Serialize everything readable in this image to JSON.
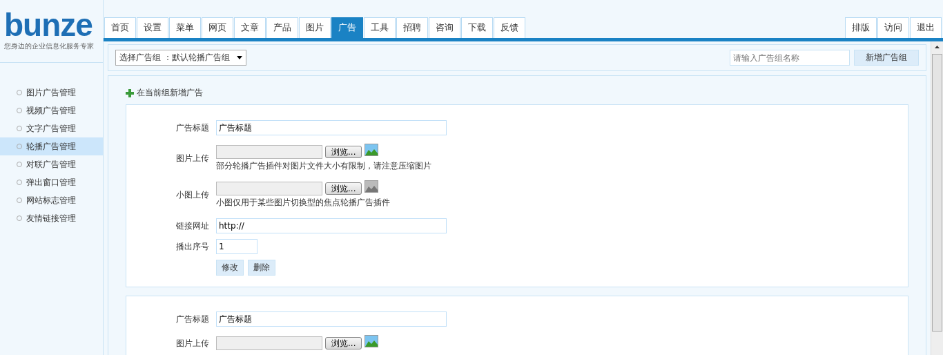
{
  "logo": {
    "name": "bunze",
    "tagline": "您身边的企业信息化服务专家"
  },
  "nav_tabs": [
    {
      "label": "首页",
      "selected": false
    },
    {
      "label": "设置",
      "selected": false
    },
    {
      "label": "菜单",
      "selected": false
    },
    {
      "label": "网页",
      "selected": false
    },
    {
      "label": "文章",
      "selected": false
    },
    {
      "label": "产品",
      "selected": false
    },
    {
      "label": "图片",
      "selected": false
    },
    {
      "label": "广告",
      "selected": true
    },
    {
      "label": "工具",
      "selected": false
    },
    {
      "label": "招聘",
      "selected": false
    },
    {
      "label": "咨询",
      "selected": false
    },
    {
      "label": "下载",
      "selected": false
    },
    {
      "label": "反馈",
      "selected": false
    }
  ],
  "nav_right": [
    "排版",
    "访问",
    "退出"
  ],
  "sidebar": {
    "items": [
      {
        "label": "图片广告管理",
        "selected": false
      },
      {
        "label": "视频广告管理",
        "selected": false
      },
      {
        "label": "文字广告管理",
        "selected": false
      },
      {
        "label": "轮播广告管理",
        "selected": true
      },
      {
        "label": "对联广告管理",
        "selected": false
      },
      {
        "label": "弹出窗口管理",
        "selected": false
      },
      {
        "label": "网站标志管理",
        "selected": false
      },
      {
        "label": "友情链接管理",
        "selected": false
      }
    ]
  },
  "toolbar": {
    "group_select": "选择广告组 ：默认轮播广告组",
    "group_name_placeholder": "请输入广告组名称",
    "add_group_button": "新增广告组"
  },
  "add_ad_link": "在当前组新增广告",
  "ad_cards": [
    {
      "title_label": "广告标题",
      "title_value": "广告标题",
      "image_label": "图片上传",
      "browse": "浏览...",
      "image_set": true,
      "image_hint": "部分轮播广告插件对图片文件大小有限制，请注意压缩图片",
      "thumb_label": "小图上传",
      "thumb_browse": "浏览...",
      "thumb_set": false,
      "thumb_hint": "小图仅用于某些图片切换型的焦点轮播广告插件",
      "link_label": "链接网址",
      "link_value": "http://",
      "order_label": "播出序号",
      "order_value": "1",
      "buttons": [
        "修改",
        "删除"
      ]
    },
    {
      "title_label": "广告标题",
      "title_value": "广告标题",
      "image_label": "图片上传",
      "browse": "浏览...",
      "image_set": true
    }
  ]
}
